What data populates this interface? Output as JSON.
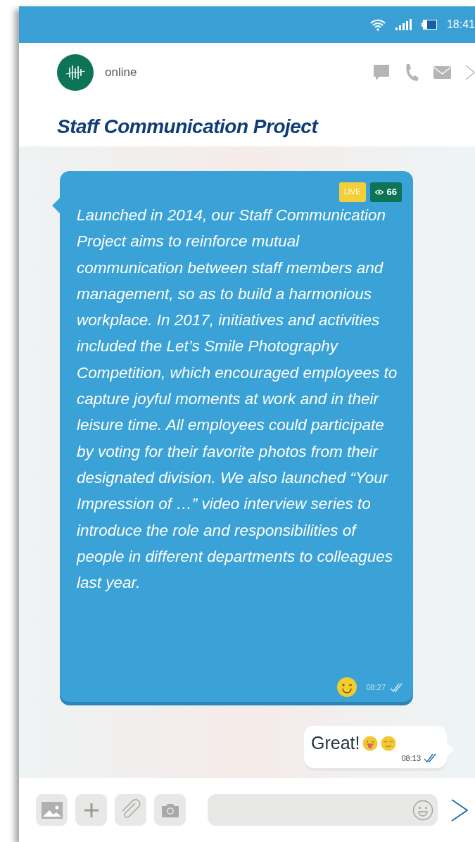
{
  "status_bar": {
    "time": "18:41"
  },
  "contact": {
    "status": "online"
  },
  "title": "Staff Communication Project",
  "messages": [
    {
      "kind": "incoming",
      "badges": [
        {
          "kind": "live",
          "text": "LIVE"
        },
        {
          "kind": "views",
          "text": "66"
        }
      ],
      "text": "Launched in 2014, our Staff Communication Project aims to reinforce mutual communication between staff members and management, so as to build a harmonious workplace. In 2017, initiatives and activities included the Let’s Smile Photography Competition, which encouraged employees to capture joyful moments at work and in their leisure time. All employees could participate by voting for their favorite photos from their designated division. We also launched “Your Impression of …” video interview series to introduce the role and responsibilities of people in different departments to colleagues last year.",
      "time": "08:27"
    },
    {
      "kind": "outgoing",
      "text": "Great!",
      "time": "08:13"
    }
  ]
}
